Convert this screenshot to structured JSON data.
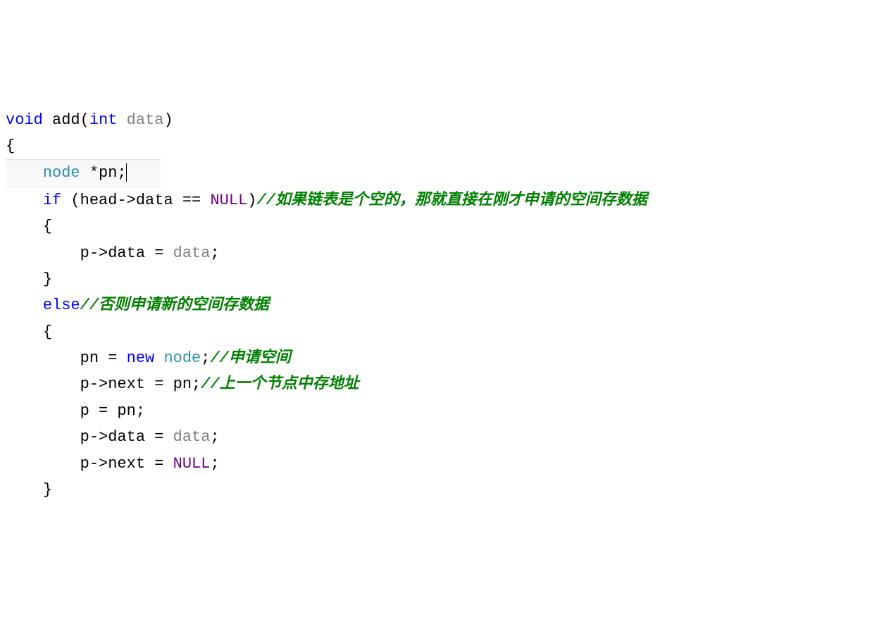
{
  "code": {
    "lines": [
      {
        "indent": "",
        "tokens": [
          {
            "t": "void",
            "c": "keyword"
          },
          {
            "t": " ",
            "c": "default"
          },
          {
            "t": "add",
            "c": "default"
          },
          {
            "t": "(",
            "c": "default"
          },
          {
            "t": "int",
            "c": "keyword"
          },
          {
            "t": " ",
            "c": "default"
          },
          {
            "t": "data",
            "c": "param"
          },
          {
            "t": ")",
            "c": "default"
          }
        ],
        "highlight": false
      },
      {
        "indent": "",
        "tokens": [
          {
            "t": "{",
            "c": "default"
          }
        ],
        "highlight": false
      },
      {
        "indent": "    ",
        "tokens": [
          {
            "t": "node",
            "c": "type"
          },
          {
            "t": " *pn;",
            "c": "default"
          }
        ],
        "highlight": true,
        "cursor": true
      },
      {
        "indent": "    ",
        "tokens": [
          {
            "t": "if",
            "c": "keyword"
          },
          {
            "t": " (head->data == ",
            "c": "default"
          },
          {
            "t": "NULL",
            "c": "null"
          },
          {
            "t": ")",
            "c": "default"
          },
          {
            "t": "//如果链表是个空的，那就直接在刚才申请的空间存数据",
            "c": "comment"
          }
        ],
        "highlight": false
      },
      {
        "indent": "    ",
        "tokens": [
          {
            "t": "{",
            "c": "default"
          }
        ],
        "highlight": false
      },
      {
        "indent": "        ",
        "tokens": [
          {
            "t": "p->data = ",
            "c": "default"
          },
          {
            "t": "data",
            "c": "param"
          },
          {
            "t": ";",
            "c": "default"
          }
        ],
        "highlight": false
      },
      {
        "indent": "    ",
        "tokens": [
          {
            "t": "}",
            "c": "default"
          }
        ],
        "highlight": false
      },
      {
        "indent": "    ",
        "tokens": [
          {
            "t": "else",
            "c": "keyword"
          },
          {
            "t": "//否则申请新的空间存数据",
            "c": "comment"
          }
        ],
        "highlight": false
      },
      {
        "indent": "    ",
        "tokens": [
          {
            "t": "{",
            "c": "default"
          }
        ],
        "highlight": false
      },
      {
        "indent": "        ",
        "tokens": [
          {
            "t": "pn = ",
            "c": "default"
          },
          {
            "t": "new",
            "c": "keyword"
          },
          {
            "t": " ",
            "c": "default"
          },
          {
            "t": "node",
            "c": "type"
          },
          {
            "t": ";",
            "c": "default"
          },
          {
            "t": "//申请空间",
            "c": "comment"
          }
        ],
        "highlight": false
      },
      {
        "indent": "        ",
        "tokens": [
          {
            "t": "p->next = pn;",
            "c": "default"
          },
          {
            "t": "//上一个节点中存地址",
            "c": "comment"
          }
        ],
        "highlight": false
      },
      {
        "indent": "        ",
        "tokens": [
          {
            "t": "p = pn;",
            "c": "default"
          }
        ],
        "highlight": false
      },
      {
        "indent": "        ",
        "tokens": [
          {
            "t": "p->data = ",
            "c": "default"
          },
          {
            "t": "data",
            "c": "param"
          },
          {
            "t": ";",
            "c": "default"
          }
        ],
        "highlight": false
      },
      {
        "indent": "        ",
        "tokens": [
          {
            "t": "p->next = ",
            "c": "default"
          },
          {
            "t": "NULL",
            "c": "null"
          },
          {
            "t": ";",
            "c": "default"
          }
        ],
        "highlight": false
      },
      {
        "indent": "    ",
        "tokens": [
          {
            "t": "}",
            "c": "default"
          }
        ],
        "highlight": false
      }
    ]
  }
}
